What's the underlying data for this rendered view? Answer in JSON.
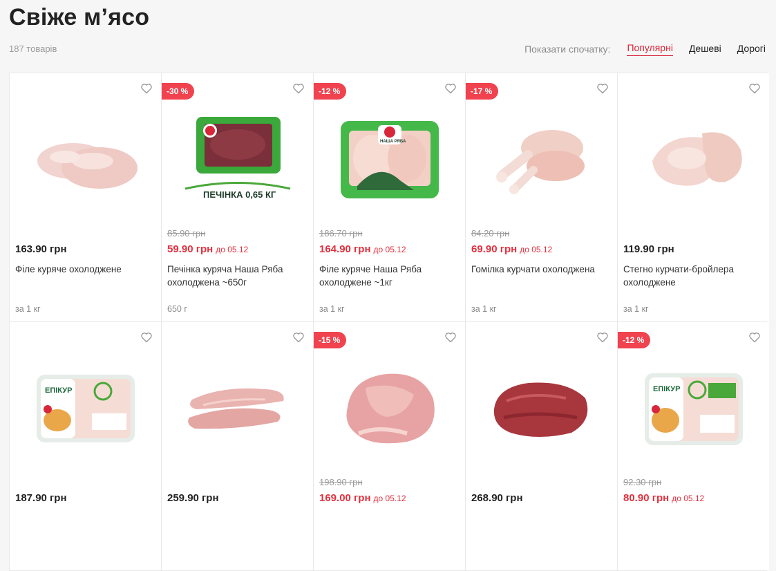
{
  "page": {
    "title": "Свіже м’ясо",
    "count": "187 товарів",
    "sort_label": "Показати спочатку:",
    "sort_options": [
      "Популярні",
      "Дешеві",
      "Дорогі"
    ],
    "accent_color": "#d8263a",
    "badge_color": "#f0424f"
  },
  "products": [
    {
      "name": "Філе куряче охолоджене",
      "price": "163.90 грн",
      "unit": "за 1 кг"
    },
    {
      "badge": "-30 %",
      "old_price": "85.90 грн",
      "price": "59.90 грн",
      "until": "до 05.12",
      "name": "Печінка куряча Наша Ряба охолоджена ~650г",
      "unit": "650 г",
      "pack_label": "ПЕЧІНКА 0,65 КГ",
      "brand": "НАША РЯБА"
    },
    {
      "badge": "-12 %",
      "old_price": "186.70 грн",
      "price": "164.90 грн",
      "until": "до 05.12",
      "name": "Філе куряче Наша Ряба охолоджене ~1кг",
      "unit": "за 1 кг",
      "brand": "НАША РЯБА"
    },
    {
      "badge": "-17 %",
      "old_price": "84.20 грн",
      "price": "69.90 грн",
      "until": "до 05.12",
      "name": "Гомілка курчати охолоджена",
      "unit": "за 1 кг"
    },
    {
      "name": "Стегно курчати-бройлера охолоджене",
      "price": "119.90 грн",
      "unit": "за 1 кг"
    },
    {
      "price": "187.90 грн",
      "brand": "ЕПІКУР"
    },
    {
      "price": "259.90 грн"
    },
    {
      "badge": "-15 %",
      "old_price": "198.90 грн",
      "price": "169.00 грн",
      "until": "до 05.12"
    },
    {
      "price": "268.90 грн"
    },
    {
      "badge": "-12 %",
      "old_price": "92.30 грн",
      "price": "80.90 грн",
      "until": "до 05.12",
      "brand": "ЕПІКУР"
    }
  ]
}
